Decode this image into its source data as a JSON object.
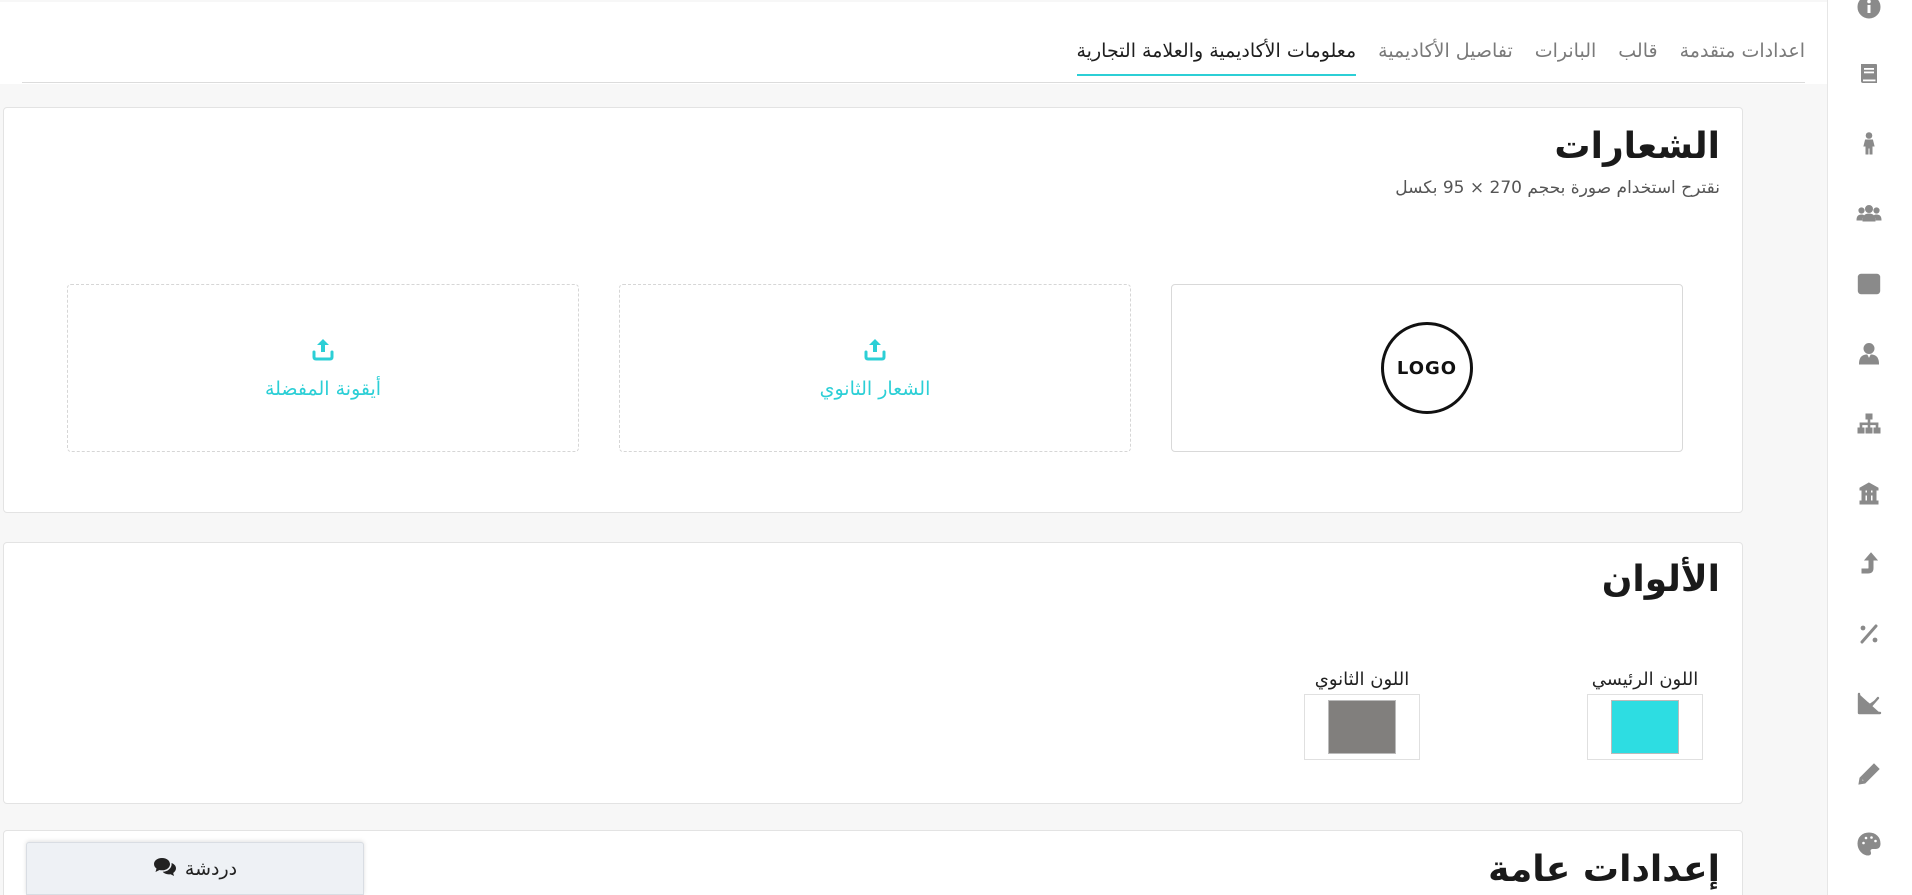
{
  "tabs": [
    {
      "label": "معلومات الأكاديمية والعلامة التجارية",
      "active": true
    },
    {
      "label": "تفاصيل الأكاديمية",
      "active": false
    },
    {
      "label": "البانرات",
      "active": false
    },
    {
      "label": "قالب",
      "active": false
    },
    {
      "label": "اعدادات متقدمة",
      "active": false
    }
  ],
  "logos": {
    "title": "الشعارات",
    "hint": "نقترح استخدام صورة بحجم 270 × 95 بكسل",
    "main_logo_text": "LOGO",
    "secondary_logo_label": "الشعار الثانوي",
    "favicon_label": "أيقونة المفضلة"
  },
  "colors": {
    "title": "الألوان",
    "primary_label": "اللون الرئيسي",
    "primary_value": "#2ddde2",
    "secondary_label": "اللون الثانوي",
    "secondary_value": "#817f7d",
    "accent": "#2ccfd6"
  },
  "general": {
    "title": "إعدادات عامة"
  },
  "chat": {
    "label": "دردشة"
  },
  "sidebar_icons": [
    "info-icon",
    "book-icon",
    "person-icon",
    "users-icon",
    "grid-icon",
    "user-tie-icon",
    "sitemap-icon",
    "building-icon",
    "turn-up-arrow-icon",
    "percent-icon",
    "line-chart-icon",
    "pencil-icon",
    "palette-icon"
  ]
}
